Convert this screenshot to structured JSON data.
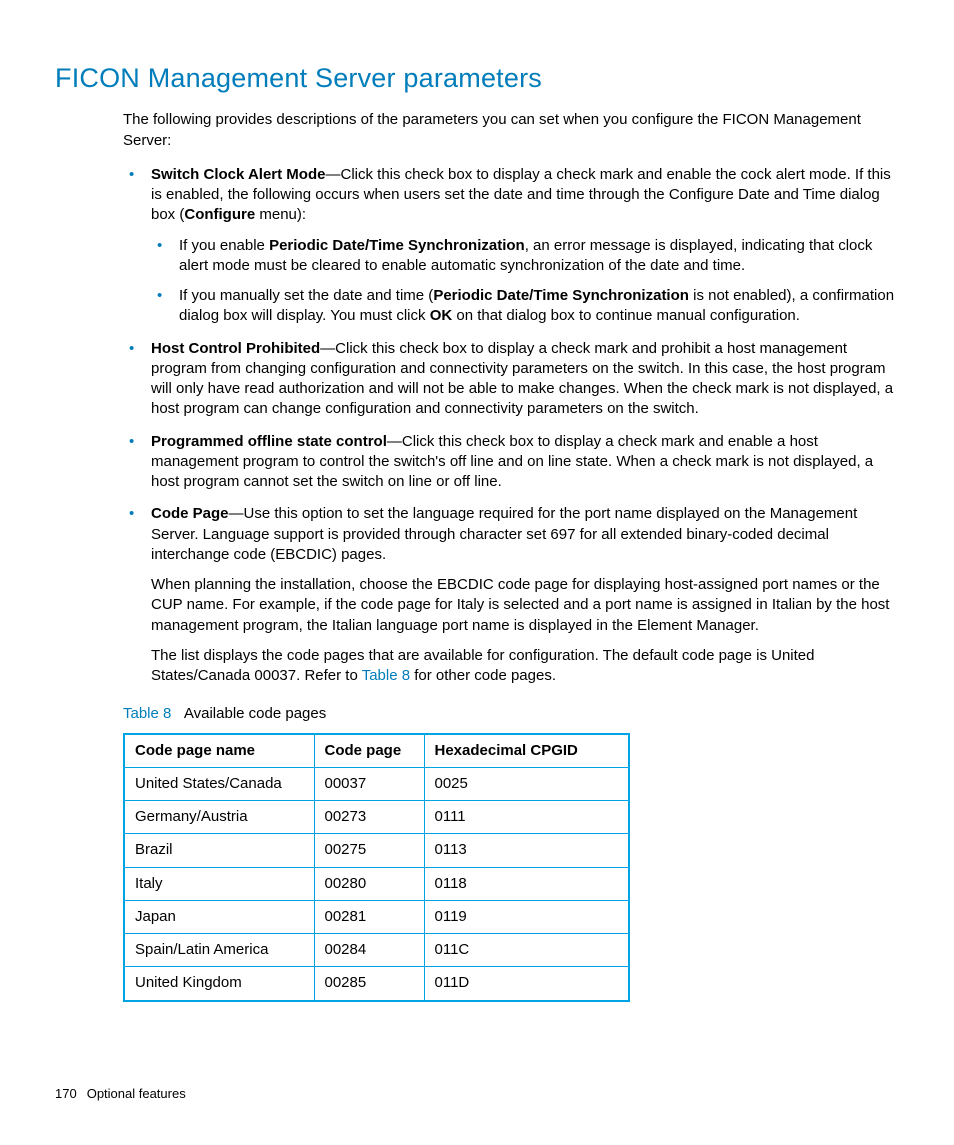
{
  "heading": "FICON Management Server parameters",
  "intro": "The following provides descriptions of the parameters you can set when you configure the FICON Management Server:",
  "bullets": {
    "switch_clock": {
      "lead": "Switch Clock Alert Mode",
      "tail1": "—Click this check box to display a check mark and enable the cock alert mode. If this is enabled, the following occurs when users set the date and time through the Configure Date and Time dialog box (",
      "configure": "Configure",
      "tail2": " menu):",
      "sub1a": "If you enable ",
      "sub1b": "Periodic Date/Time Synchronization",
      "sub1c": ", an error message is displayed, indicating that clock alert mode must be cleared to enable automatic synchronization of the date and time.",
      "sub2a": "If you manually set the date and time (",
      "sub2b": "Periodic Date/Time Synchronization",
      "sub2c": " is not enabled), a confirmation dialog box will display. You must click ",
      "sub2d": "OK",
      "sub2e": " on that dialog box to continue manual configuration."
    },
    "host_control": {
      "lead": "Host Control Prohibited",
      "tail": "—Click this check box to display a check mark and prohibit a host management program from changing configuration and connectivity parameters on the switch. In this case, the host program will only have read authorization and will not be able to make changes. When the check mark is not displayed, a host program can change configuration and connectivity parameters on the switch."
    },
    "offline": {
      "lead": "Programmed offline state control",
      "tail": "—Click this check box to display a check mark and enable a host management program to control the switch's off line and on line state. When a check mark is not displayed, a host program cannot set the switch on line or off line."
    },
    "code_page": {
      "lead": "Code Page",
      "tail": "—Use this option to set the language required for the port name displayed on the Management Server. Language support is provided through character set 697 for all extended binary-coded decimal interchange code (EBCDIC) pages.",
      "p2": "When planning the installation, choose the EBCDIC code page for displaying host-assigned port names or the CUP name. For example, if the code page for Italy is selected and a port name is assigned in Italian by the host management program, the Italian language port name is displayed in the Element Manager.",
      "p3a": "The list displays the code pages that are available for configuration. The default code page is United States/Canada 00037. Refer to ",
      "p3link": "Table 8",
      "p3b": " for other code pages."
    }
  },
  "table": {
    "caption_label": "Table 8",
    "caption_text": "Available code pages",
    "headers": {
      "c0": "Code page name",
      "c1": "Code page",
      "c2": "Hexadecimal CPGID"
    },
    "rows": [
      {
        "c0": "United States/Canada",
        "c1": "00037",
        "c2": "0025"
      },
      {
        "c0": "Germany/Austria",
        "c1": "00273",
        "c2": "0111"
      },
      {
        "c0": "Brazil",
        "c1": "00275",
        "c2": "0113"
      },
      {
        "c0": "Italy",
        "c1": "00280",
        "c2": "0118"
      },
      {
        "c0": "Japan",
        "c1": "00281",
        "c2": "0119"
      },
      {
        "c0": "Spain/Latin America",
        "c1": "00284",
        "c2": "011C"
      },
      {
        "c0": "United Kingdom",
        "c1": "00285",
        "c2": "011D"
      }
    ]
  },
  "footer": {
    "page": "170",
    "section": "Optional features"
  }
}
